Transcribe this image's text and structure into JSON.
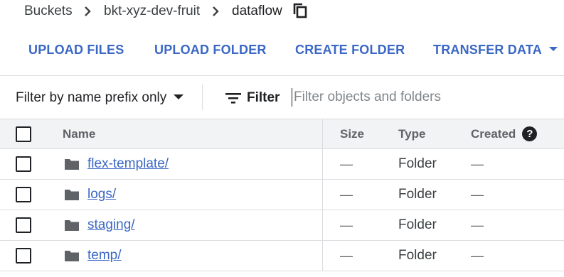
{
  "breadcrumb": {
    "items": [
      "Buckets",
      "bkt-xyz-dev-fruit",
      "dataflow"
    ],
    "separator_icon": "chevron-right-icon",
    "copy_icon": "copy-icon"
  },
  "actions": {
    "upload_files": "UPLOAD FILES",
    "upload_folder": "UPLOAD FOLDER",
    "create_folder": "CREATE FOLDER",
    "transfer_data": "TRANSFER DATA"
  },
  "filter": {
    "prefix_label": "Filter by name prefix only",
    "label": "Filter",
    "placeholder": "Filter objects and folders",
    "value": ""
  },
  "table": {
    "headers": {
      "name": "Name",
      "size": "Size",
      "type": "Type",
      "created": "Created"
    },
    "help_glyph": "?",
    "rows": [
      {
        "name": "flex-template/",
        "size": "—",
        "type": "Folder",
        "created": "—"
      },
      {
        "name": "logs/",
        "size": "—",
        "type": "Folder",
        "created": "—"
      },
      {
        "name": "staging/",
        "size": "—",
        "type": "Folder",
        "created": "—"
      },
      {
        "name": "temp/",
        "size": "—",
        "type": "Folder",
        "created": "—"
      }
    ]
  },
  "colors": {
    "accent": "#3b67c5",
    "header_bg": "#f1f3f4",
    "divider": "#dadce0",
    "folder": "#5f6368"
  }
}
